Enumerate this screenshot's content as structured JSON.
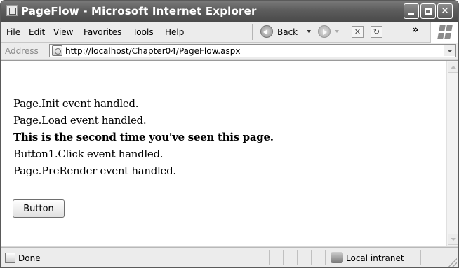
{
  "window": {
    "title": "PageFlow - Microsoft Internet Explorer"
  },
  "menu": {
    "items": [
      {
        "label": "File",
        "key": "F"
      },
      {
        "label": "Edit",
        "key": "E"
      },
      {
        "label": "View",
        "key": "V"
      },
      {
        "label": "Favorites",
        "key": "a"
      },
      {
        "label": "Tools",
        "key": "T"
      },
      {
        "label": "Help",
        "key": "H"
      }
    ],
    "back_label": "Back",
    "chevron": "»"
  },
  "address": {
    "label": "Address",
    "url": "http://localhost/Chapter04/PageFlow.aspx"
  },
  "page": {
    "lines": [
      {
        "text": "Page.Init event handled.",
        "bold": false
      },
      {
        "text": "Page.Load event handled.",
        "bold": false
      },
      {
        "text": "This is the second time you've seen this page.",
        "bold": true
      },
      {
        "text": "Button1.Click event handled.",
        "bold": false
      },
      {
        "text": "Page.PreRender event handled.",
        "bold": false
      }
    ],
    "button_label": "Button"
  },
  "status": {
    "text": "Done",
    "zone": "Local intranet"
  }
}
